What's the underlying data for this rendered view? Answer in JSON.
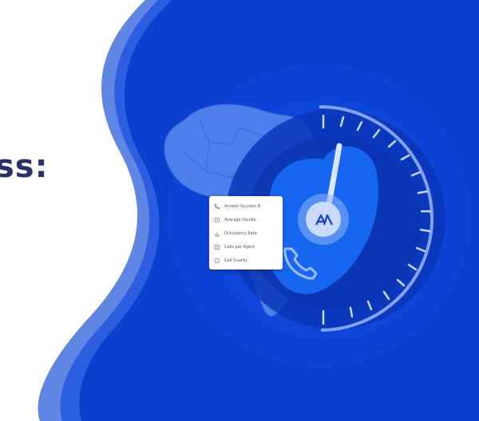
{
  "heading": {
    "text": "ss:"
  },
  "metrics": [
    {
      "label": "Answer Success R",
      "icon": "phone-icon"
    },
    {
      "label": "Average Handle",
      "icon": "clock-icon"
    },
    {
      "label": "Occupancy Rate",
      "icon": "bar-chart-icon"
    },
    {
      "label": "Calls per Agent",
      "icon": "agent-list-icon"
    },
    {
      "label": "Call Quality",
      "icon": "smiley-icon"
    }
  ],
  "colors": {
    "background_blue": "#0a3fd0",
    "light_blue_wave": "#5b83e0",
    "heading": "#2b2f6b",
    "shield_blue": "#1665f0"
  },
  "icons": {
    "logo": "brand-logo-icon",
    "phone": "phone-icon",
    "gauge": "speedometer-gauge-icon",
    "map": "africa-map-icon"
  }
}
